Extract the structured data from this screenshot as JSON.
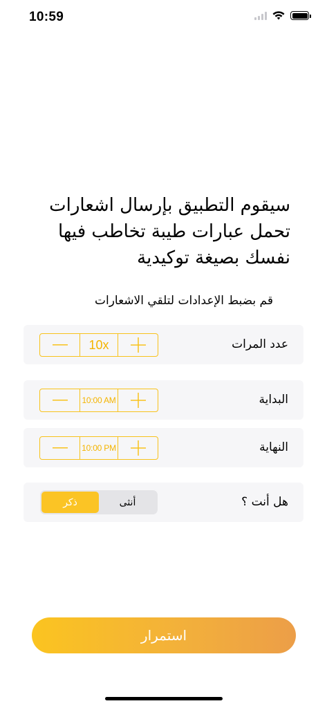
{
  "status_bar": {
    "time": "10:59"
  },
  "headline": "سيقوم التطبيق بإرسال اشعارات تحمل عبارات طيبة تخاطب فيها نفسك بصيغة توكيدية",
  "subtitle": "قم بضبط الإعدادات لتلقي الاشعارات",
  "settings": {
    "count": {
      "label": "عدد المرات",
      "value": "10x"
    },
    "start": {
      "label": "البداية",
      "value": "10:00 AM"
    },
    "end": {
      "label": "النهاية",
      "value": "10:00 PM"
    }
  },
  "gender": {
    "label": "هل أنت ؟",
    "options": [
      "أنثى",
      "ذكر"
    ],
    "selected": "ذكر"
  },
  "continue_label": "استمرار",
  "colors": {
    "accent": "#F8C21A",
    "row_bg": "#F6F6F8",
    "button_end": "#EC9E48"
  }
}
